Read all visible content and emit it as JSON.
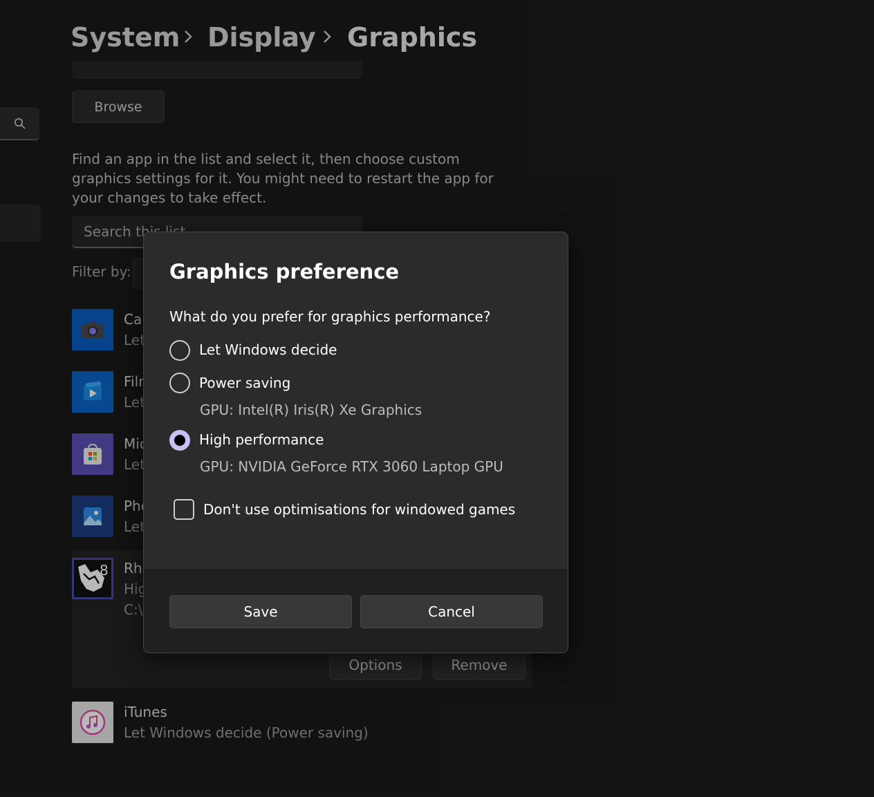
{
  "breadcrumb": {
    "items": [
      "System",
      "Display",
      "Graphics"
    ]
  },
  "settings": {
    "browse_label": "Browse",
    "description": "Find an app in the list and select it, then choose custom graphics settings for it. You might need to restart the app for your changes to take effect.",
    "search_placeholder": "Search this list",
    "filter_label": "Filter by:",
    "apps": [
      {
        "name": "Car",
        "subtitle": "Let",
        "icon": "camera-icon",
        "color": "#0a5ec4"
      },
      {
        "name": "Film",
        "subtitle": "Let",
        "icon": "film-icon",
        "color": "#0b64c8"
      },
      {
        "name": "Mic",
        "subtitle": "Let",
        "icon": "store-icon",
        "color": "#5b4fb3"
      },
      {
        "name": "Pho",
        "subtitle": "Let",
        "icon": "photos-icon",
        "color": "#1d3d82"
      },
      {
        "name": "Rhi",
        "subtitle": "Hig",
        "path": "C:\\",
        "icon": "rhino-icon",
        "color": "#4a4aa8"
      }
    ],
    "options_label": "Options",
    "remove_label": "Remove",
    "itunes": {
      "name": "iTunes",
      "subtitle": "Let Windows decide (Power saving)",
      "icon": "itunes-icon"
    }
  },
  "dialog": {
    "title": "Graphics preference",
    "question": "What do you prefer for graphics performance?",
    "options": [
      {
        "label": "Let Windows decide",
        "selected": false
      },
      {
        "label": "Power saving",
        "gpu": "GPU: Intel(R) Iris(R) Xe Graphics",
        "selected": false
      },
      {
        "label": "High performance",
        "gpu": "GPU: NVIDIA GeForce RTX 3060 Laptop GPU",
        "selected": true
      }
    ],
    "checkbox_label": "Don't use optimisations for windowed games",
    "checkbox_checked": false,
    "save_label": "Save",
    "cancel_label": "Cancel"
  },
  "colors": {
    "accent": "#c9bff0",
    "background": "#1a1a1a",
    "dialog": "#2b2b2b"
  }
}
